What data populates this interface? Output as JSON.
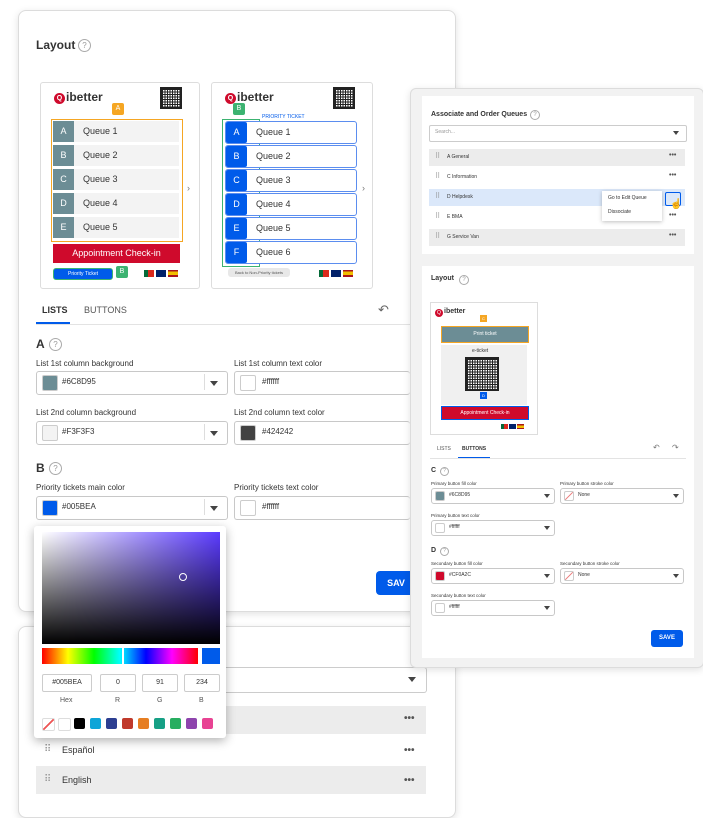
{
  "left_panel": {
    "layout_title": "Layout",
    "preview1": {
      "logo_letter": "Q",
      "logo_text": "ibetter",
      "marker_a": "A",
      "marker_b": "B",
      "queues": [
        {
          "letter": "A",
          "label": "Queue 1"
        },
        {
          "letter": "B",
          "label": "Queue 2"
        },
        {
          "letter": "C",
          "label": "Queue 3"
        },
        {
          "letter": "D",
          "label": "Queue 4"
        },
        {
          "letter": "E",
          "label": "Queue 5"
        }
      ],
      "checkin_label": "Appointment Check-in",
      "priority_label": "Priority Ticket"
    },
    "preview2": {
      "logo_letter": "Q",
      "logo_text": "ibetter",
      "marker_b": "B",
      "priority_header": "PRIORITY TICKET",
      "queues": [
        {
          "letter": "A",
          "label": "Queue 1"
        },
        {
          "letter": "B",
          "label": "Queue 2"
        },
        {
          "letter": "C",
          "label": "Queue 3"
        },
        {
          "letter": "D",
          "label": "Queue 4"
        },
        {
          "letter": "E",
          "label": "Queue 5"
        },
        {
          "letter": "F",
          "label": "Queue 6"
        }
      ],
      "back_label": "Back to Non-Priority tickets"
    },
    "tabs": [
      "LISTS",
      "BUTTONS"
    ],
    "section_a": "A",
    "section_b": "B",
    "fields": {
      "list1_bg_label": "List 1st column background",
      "list1_bg_value": "#6C8D95",
      "list1_text_label": "List 1st column text color",
      "list1_text_value": "#ffffff",
      "list2_bg_label": "List 2nd column background",
      "list2_bg_value": "#F3F3F3",
      "list2_text_label": "List 2nd column text color",
      "list2_text_value": "#424242",
      "priority_main_label": "Priority tickets main color",
      "priority_main_value": "#005BEA",
      "priority_text_label": "Priority tickets text color",
      "priority_text_value": "#ffffff"
    },
    "save_label": "SAV",
    "languages": [
      "Español",
      "English"
    ]
  },
  "color_picker": {
    "hex": "#005BEA",
    "r": "0",
    "g": "91",
    "b": "234",
    "hex_label": "Hex",
    "r_label": "R",
    "g_label": "G",
    "b_label": "B",
    "presets": [
      "none",
      "#ffffff",
      "#000000",
      "#0ea5d8",
      "#2c3e91",
      "#c0392b",
      "#e67e22",
      "#16a085",
      "#27ae60",
      "#8e44ad",
      "#e84393"
    ]
  },
  "right_panel": {
    "assoc_title": "Associate and Order Queues",
    "search_placeholder": "Search...",
    "queues": [
      {
        "label": "A General"
      },
      {
        "label": "C Information"
      },
      {
        "label": "D Helpdesk"
      },
      {
        "label": "E BMA"
      },
      {
        "label": "G Service Van"
      }
    ],
    "menu_items": [
      "Go to Edit Queue",
      "Dissociate"
    ],
    "layout_title": "Layout",
    "preview": {
      "logo_letter": "Q",
      "logo_text": "ibetter",
      "print_ticket": "Print ticket",
      "eticket": "e-ticket",
      "checkin": "Appointment Check-in",
      "marker_c": "C",
      "marker_d": "D"
    },
    "tabs": [
      "LISTS",
      "BUTTONS"
    ],
    "section_c": "C",
    "section_d": "D",
    "fields": {
      "primary_fill_label": "Primary button fill color",
      "primary_fill_value": "#6C8D95",
      "primary_stroke_label": "Primary button stroke color",
      "primary_stroke_value": "None",
      "primary_text_label": "Primary button text color",
      "primary_text_value": "#ffffff",
      "secondary_fill_label": "Secondary button fill color",
      "secondary_fill_value": "#CF0A2C",
      "secondary_stroke_label": "Secondary button stroke color",
      "secondary_stroke_value": "None",
      "secondary_text_label": "Secondary button text color",
      "secondary_text_value": "#ffffff"
    },
    "save_label": "SAVE"
  },
  "colors": {
    "accent": "#005BEA",
    "list_bg": "#6C8D95",
    "red": "#CF0A2C",
    "orange": "#f5a623",
    "green": "#3cb371"
  }
}
